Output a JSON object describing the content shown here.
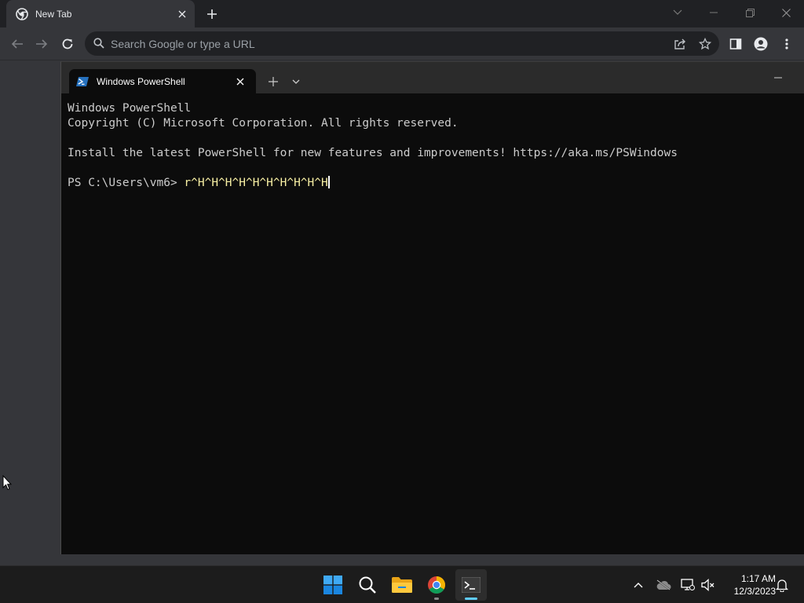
{
  "chrome": {
    "tab_title": "New Tab",
    "omnibox_placeholder": "Search Google or type a URL"
  },
  "terminal": {
    "tab_title": "Windows PowerShell",
    "lines": [
      "Windows PowerShell",
      "Copyright (C) Microsoft Corporation. All rights reserved.",
      "",
      "Install the latest PowerShell for new features and improvements! https://aka.ms/PSWindows",
      ""
    ],
    "prompt": "PS C:\\Users\\vm6> ",
    "typed_input": "r^H^H^H^H^H^H^H^H^H^H"
  },
  "taskbar": {
    "time": "1:17 AM",
    "date": "12/3/2023",
    "apps": [
      "start-icon",
      "search-icon",
      "file-explorer-icon",
      "chrome-icon",
      "terminal-icon"
    ]
  },
  "colors": {
    "terminal_bg": "#0c0c0c",
    "terminal_text": "#cccccc",
    "typed_text": "#f9f1a5",
    "chrome_bg": "#35363a",
    "taskbar_bg": "#1c1c1c",
    "accent": "#60cdff"
  }
}
